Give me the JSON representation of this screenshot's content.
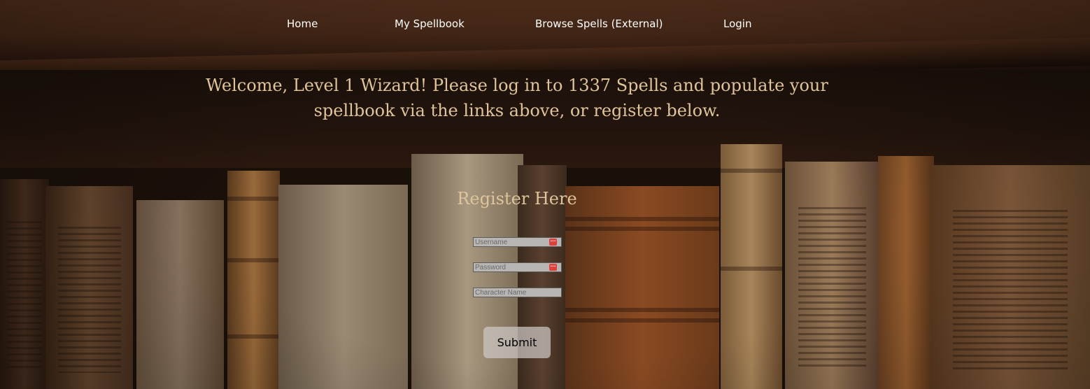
{
  "nav": {
    "items": [
      {
        "label": "Home"
      },
      {
        "label": "My Spellbook"
      },
      {
        "label": "Browse Spells (External)"
      },
      {
        "label": "Login"
      }
    ]
  },
  "welcome": {
    "text": "Welcome, Level 1 Wizard! Please log in to 1337 Spells and populate your spellbook via the links above, or register below."
  },
  "register": {
    "title": "Register Here",
    "username_placeholder": "Username",
    "password_placeholder": "Password",
    "character_placeholder": "Character Name",
    "submit_label": "Submit"
  },
  "icons": {
    "field_icon": "password-manager-icon",
    "field_icon_color": "#e0403b"
  },
  "colors": {
    "accent_text": "#dfc39a",
    "nav_text": "#ffffff",
    "button_bg": "#cdc8c4"
  }
}
